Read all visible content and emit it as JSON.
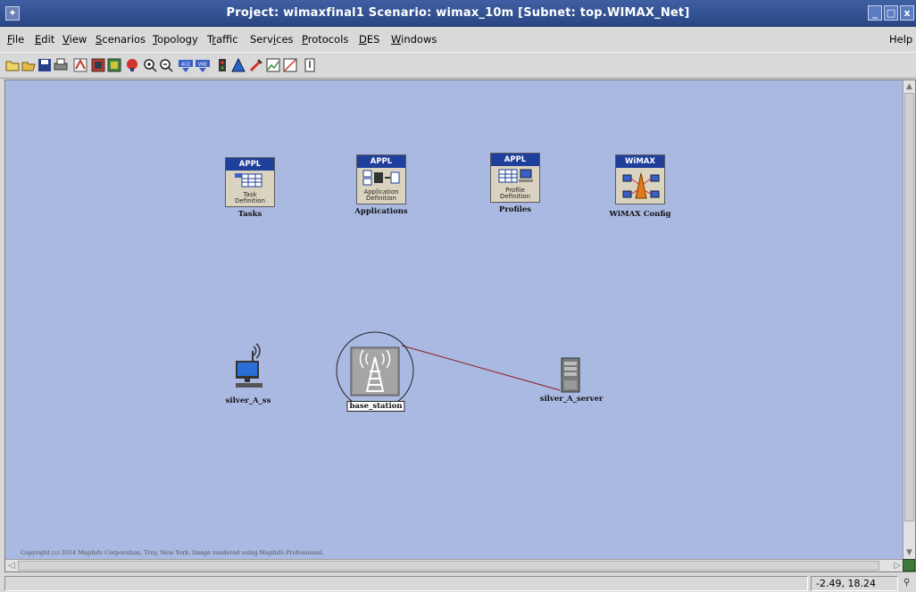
{
  "window": {
    "title": "Project: wimaxfinal1 Scenario: wimax_10m  [Subnet: top.WIMAX_Net]",
    "app_icon": "opnet-app-icon",
    "buttons": [
      "minimize-icon",
      "maximize-icon",
      "close-icon"
    ]
  },
  "menu": {
    "items": [
      {
        "label": "File",
        "underline": "F"
      },
      {
        "label": "Edit",
        "underline": "E"
      },
      {
        "label": "View",
        "underline": "V"
      },
      {
        "label": "Scenarios",
        "underline": "S"
      },
      {
        "label": "Topology",
        "underline": "T"
      },
      {
        "label": "Traffic",
        "underline": "r"
      },
      {
        "label": "Services",
        "underline": "i"
      },
      {
        "label": "Protocols",
        "underline": "P"
      },
      {
        "label": "DES",
        "underline": "D"
      },
      {
        "label": "Windows",
        "underline": "W"
      }
    ],
    "help": "Help"
  },
  "toolbar": {
    "icons": [
      "open-folder-icon",
      "open-file-icon",
      "save-icon",
      "print-icon",
      "config-node-icon",
      "object-palette-icon",
      "rapid-config-icon",
      "fail-node-icon",
      "zoom-in-icon",
      "zoom-out-icon",
      "ace-icon",
      "vne-icon",
      "traffic-icon",
      "topology-icon",
      "configure-run-icon",
      "view-results-icon",
      "web-report-icon",
      "hide-graphs-icon"
    ]
  },
  "canvas": {
    "background": "#aab9e2",
    "nodes": {
      "tasks": {
        "header": "APPL",
        "icon_caption": [
          "Task",
          "Definition"
        ],
        "label": "Tasks"
      },
      "applications": {
        "header": "APPL",
        "icon_caption": [
          "Application",
          "Definition"
        ],
        "label": "Applications"
      },
      "profiles": {
        "header": "APPL",
        "icon_caption": [
          "Profile",
          "Definition"
        ],
        "label": "Profiles"
      },
      "wimax_config": {
        "header": "WiMAX",
        "label": "WiMAX Config"
      },
      "subscriber": {
        "label": "silver_A_ss"
      },
      "base_station": {
        "label": "base_station"
      },
      "server": {
        "label": "silver_A_server"
      }
    },
    "link_color": "#8b1a1a",
    "copyright": "Copyright (c) 2014 MapInfo Corporation, Troy, New York. Image rendered using MapInfo Professional."
  },
  "status": {
    "coordinates": "-2.49, 18.24"
  }
}
